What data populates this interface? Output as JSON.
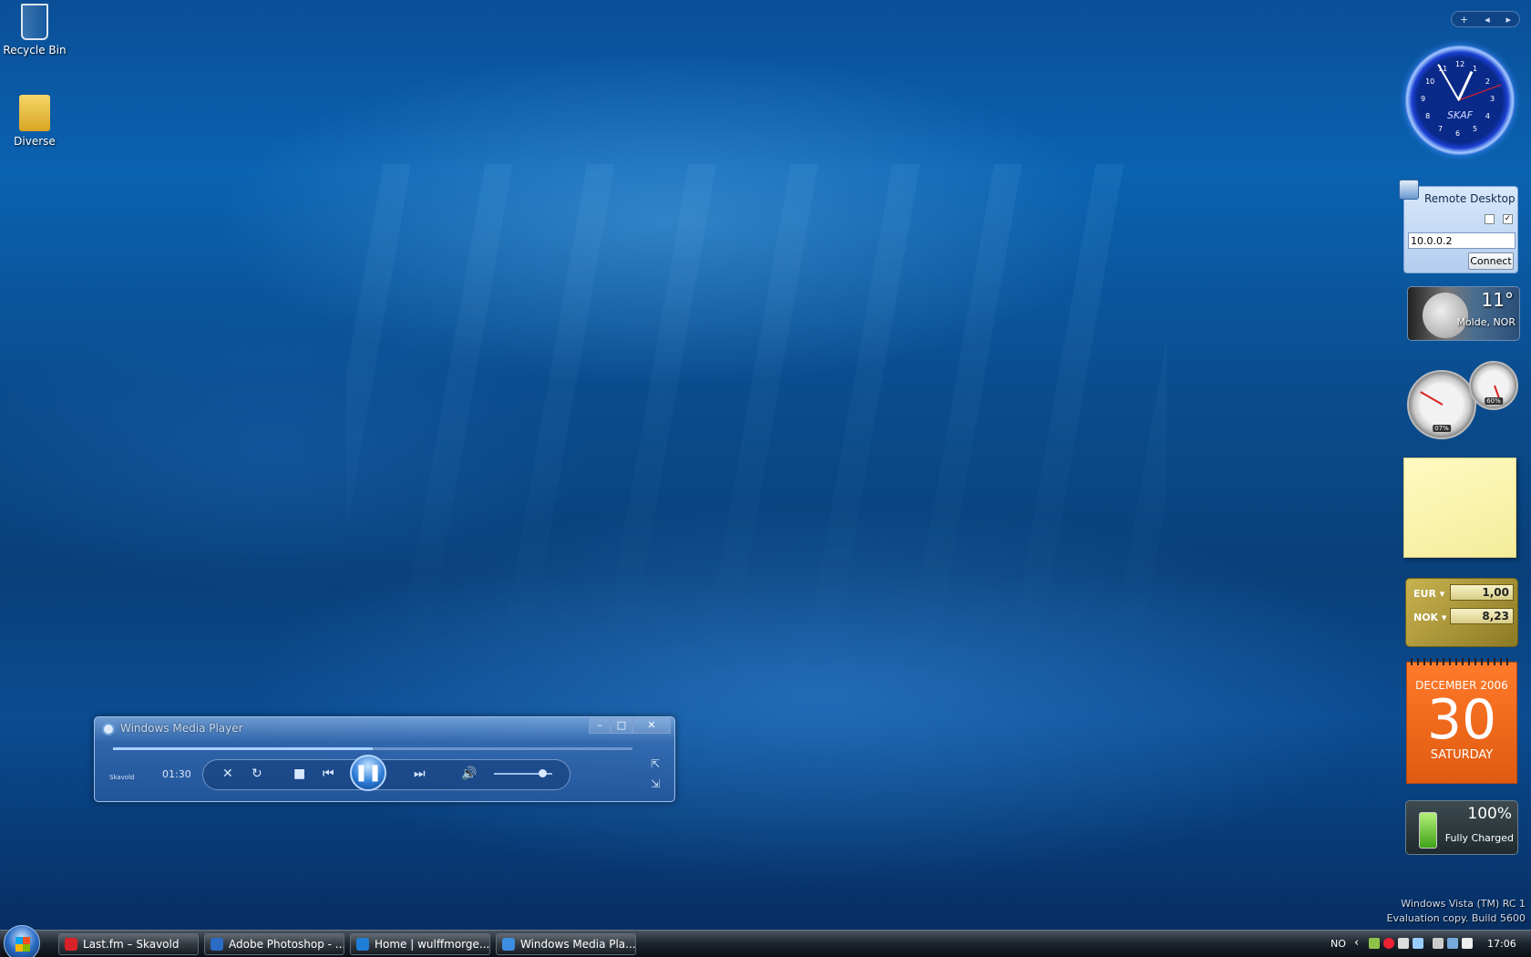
{
  "desktop": {
    "icons": [
      {
        "label": "Recycle Bin"
      },
      {
        "label": "Diverse"
      }
    ]
  },
  "wmp": {
    "title": "Windows Media Player",
    "time": "01:30",
    "small_text": "Skavold",
    "progress": 0.5,
    "volume": 0.9,
    "buttons": {
      "minimize": "–",
      "maximize": "□",
      "close": "✕"
    }
  },
  "sidebar": {
    "top_controls": {
      "add": "+",
      "prev": "◂",
      "next": "▸"
    },
    "clock": {
      "label": "SKAF",
      "hours": [
        "12",
        "1",
        "2",
        "3",
        "4",
        "5",
        "6",
        "7",
        "8",
        "9",
        "10",
        "11"
      ]
    },
    "remote_desktop": {
      "title": "Remote Desktop",
      "address": "10.0.0.2",
      "connect_label": "Connect",
      "check1": "",
      "check2": "✓"
    },
    "weather": {
      "temp": "11°",
      "location": "Molde, NOR"
    },
    "cpu_meter": {
      "cpu": "07%",
      "memory": "60%"
    },
    "currency": {
      "from_code": "EUR",
      "from_value": "1,00",
      "to_code": "NOK",
      "to_value": "8,23"
    },
    "calendar": {
      "month": "DECEMBER 2006",
      "day": "30",
      "weekday": "SATURDAY"
    },
    "battery": {
      "percent": "100%",
      "status": "Fully Charged"
    }
  },
  "watermark": {
    "line1": "Windows Vista (TM) RC 1",
    "line2": "Evaluation copy. Build 5600"
  },
  "taskbar": {
    "items": [
      {
        "label": "Last.fm – Skavold",
        "color": "#d8222a"
      },
      {
        "label": "Adobe Photoshop - ...",
        "color": "#2b6bc4"
      },
      {
        "label": "Home | wulffmorge...",
        "color": "#1f7fd8"
      },
      {
        "label": "Windows Media Pla...",
        "color": "#3d8ee0"
      }
    ],
    "language": "NO",
    "clock": "17:06",
    "chevron": "‹"
  }
}
